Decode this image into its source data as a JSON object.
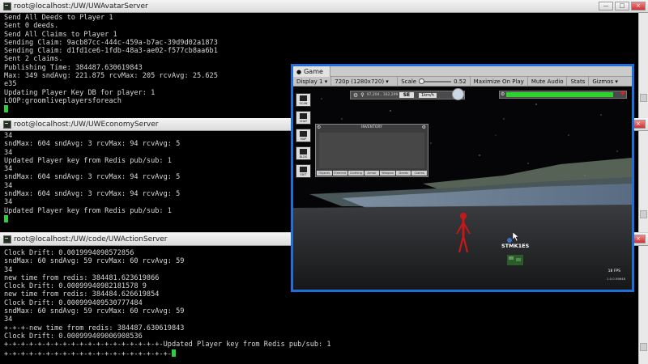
{
  "window_buttons": {
    "minimize": "—",
    "maximize": "□",
    "close": "×"
  },
  "terminals": [
    {
      "title": "root@localhost:/UW/UWAvatarServer",
      "lines": [
        "Send All Deeds to Player 1",
        "Sent 0 deeds.",
        "Send All Claims to Player 1",
        "Sending Claim: 9acb87cc-444c-459a-b7ac-39d9d02a1873",
        "Sending Claim: d1fd1ce6-1fdb-48a3-ae02-f577cb8aa6b1",
        "Sent 2 claims.",
        "Publishing Time: 384487.630619843",
        "Max: 349 sndAvg: 221.875 rcvMax: 205 rcvAvg: 25.625",
        "e35",
        "Updating Player Key DB for player: 1",
        "LOOP:groomliveplayersforeach"
      ]
    },
    {
      "title": "root@localhost:/UW/UWEconomyServer",
      "lines": [
        "34",
        "sndMax: 604 sndAvg: 3 rcvMax: 94 rcvAvg: 5",
        "34",
        "Updated Player key from Redis pub/sub: 1",
        "34",
        "sndMax: 604 sndAvg: 3 rcvMax: 94 rcvAvg: 5",
        "34",
        "sndMax: 604 sndAvg: 3 rcvMax: 94 rcvAvg: 5",
        "34",
        "Updated Player key from Redis pub/sub: 1"
      ]
    },
    {
      "title": "root@localhost:/UW/code/UWActionServer",
      "lines": [
        "Clock Drift: 0.0019994098572856",
        "sndMax: 60 sndAvg: 59 rcvMax: 60 rcvAvg: 59",
        "34",
        "new time from redis: 384481.623619866",
        "Clock Drift: 0.00099940982181578 9",
        "new time from redis: 384484.626619854",
        "Clock Drift: 0.000999409530777484",
        "sndMax: 60 sndAvg: 59 rcvMax: 60 rcvAvg: 59",
        "34",
        "+-+-+-new time from redis: 384487.630619843",
        "Clock Drift: 0.000999409006908536",
        "+-+-+-+-+-+-+-+-+-+-+-+-+-+-+-+-+-+-+-Updated Player key from Redis pub/sub: 1",
        "+-+-+-+-+-+-+-+-+-+-+-+-+-+-+-+-+-+-+-+-"
      ]
    }
  ],
  "game": {
    "tab_label": "Game",
    "display": "Display 1",
    "resolution": "720p (1280x720)",
    "scale_label": "Scale",
    "scale_value": "0.52",
    "scale_fraction": 0.0,
    "maximize_on_play": "Maximize On Play",
    "mute_audio": "Mute Audio",
    "stats": "Stats",
    "gizmos": "Gizmos",
    "compass": {
      "coords": "97,204 , 162,299",
      "heading": "SE",
      "speed": "1km/h"
    },
    "health_fraction": 0.96,
    "inventory": {
      "title": "INVENTORY",
      "tabs": [
        "Objects",
        "Element",
        "Clothing",
        "Armor",
        "Weapon",
        "Deeds",
        "Claims"
      ]
    },
    "side_buttons": [
      "SCAN",
      "CHAT",
      "MAP",
      "BLDG",
      "EXIT"
    ],
    "object_label": "STMK1ES",
    "fps": "18 FPS",
    "version": "1.0.0.56648",
    "colors": {
      "health": "#2fd12f",
      "figure": "#c71818",
      "frame": "#1e6fd9"
    }
  }
}
